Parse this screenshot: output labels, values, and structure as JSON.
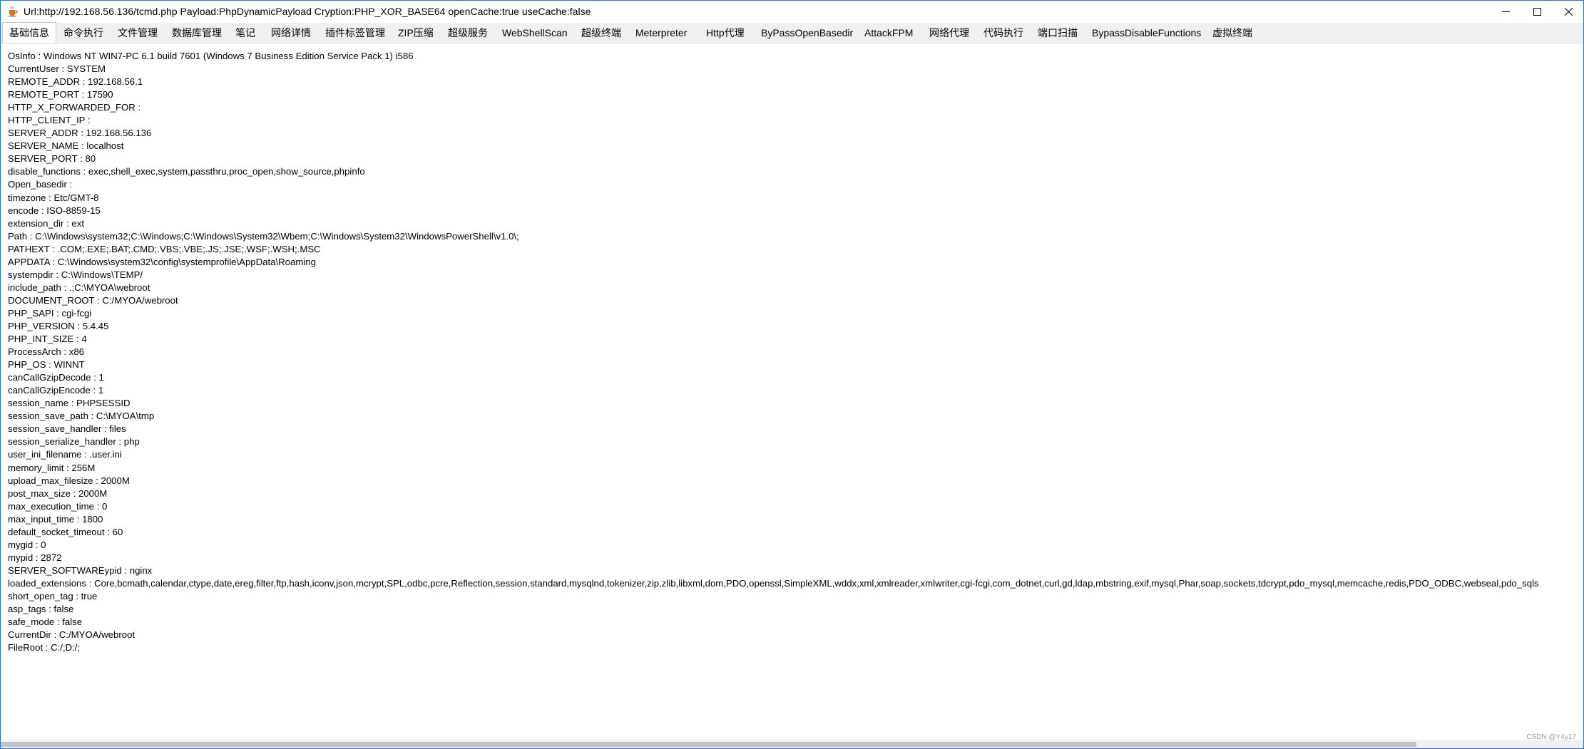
{
  "window": {
    "title": "Url:http://192.168.56.136/tcmd.php Payload:PhpDynamicPayload Cryption:PHP_XOR_BASE64 openCache:true useCache:false",
    "icons": {
      "app": "java-cup-icon",
      "minimize": "minimize-icon",
      "maximize": "maximize-icon",
      "close": "close-icon"
    }
  },
  "tabs": [
    {
      "label": "基础信息",
      "active": true
    },
    {
      "label": "命令执行"
    },
    {
      "label": "文件管理"
    },
    {
      "label": "数据库管理"
    },
    {
      "label": "笔记"
    },
    {
      "label": "网络详情"
    },
    {
      "label": "插件标签管理"
    },
    {
      "label": "ZIP压缩"
    },
    {
      "label": "超级服务"
    },
    {
      "label": "WebShellScan"
    },
    {
      "label": "超级终端"
    },
    {
      "label": "Meterpreter"
    },
    {
      "label": "Http代理"
    },
    {
      "label": "ByPassOpenBasedir"
    },
    {
      "label": "AttackFPM"
    },
    {
      "label": "网络代理"
    },
    {
      "label": "代码执行"
    },
    {
      "label": "端口扫描"
    },
    {
      "label": "BypassDisableFunctions"
    },
    {
      "label": "虚拟终端"
    }
  ],
  "info_lines": [
    "OsInfo : Windows NT WIN7-PC 6.1 build 7601 (Windows 7 Business Edition Service Pack 1) i586",
    "CurrentUser : SYSTEM",
    "REMOTE_ADDR : 192.168.56.1",
    "REMOTE_PORT : 17590",
    "HTTP_X_FORWARDED_FOR :",
    "HTTP_CLIENT_IP :",
    "SERVER_ADDR : 192.168.56.136",
    "SERVER_NAME : localhost",
    "SERVER_PORT : 80",
    "disable_functions : exec,shell_exec,system,passthru,proc_open,show_source,phpinfo",
    "Open_basedir :",
    "timezone : Etc/GMT-8",
    "encode : ISO-8859-15",
    "extension_dir : ext",
    "Path : C:\\Windows\\system32;C:\\Windows;C:\\Windows\\System32\\Wbem;C:\\Windows\\System32\\WindowsPowerShell\\v1.0\\;",
    "PATHEXT : .COM;.EXE;.BAT;.CMD;.VBS;.VBE;.JS;.JSE;.WSF;.WSH;.MSC",
    "APPDATA : C:\\Windows\\system32\\config\\systemprofile\\AppData\\Roaming",
    "systempdir : C:\\Windows\\TEMP/",
    "include_path : .;C:\\MYOA\\webroot",
    "DOCUMENT_ROOT : C:/MYOA/webroot",
    "PHP_SAPI : cgi-fcgi",
    "PHP_VERSION : 5.4.45",
    "PHP_INT_SIZE : 4",
    "ProcessArch : x86",
    "PHP_OS : WINNT",
    "canCallGzipDecode : 1",
    "canCallGzipEncode : 1",
    "session_name : PHPSESSID",
    "session_save_path : C:\\MYOA\\tmp",
    "session_save_handler : files",
    "session_serialize_handler : php",
    "user_ini_filename : .user.ini",
    "memory_limit : 256M",
    "upload_max_filesize : 2000M",
    "post_max_size : 2000M",
    "max_execution_time : 0",
    "max_input_time : 1800",
    "default_socket_timeout : 60",
    "mygid : 0",
    "mypid : 2872",
    "SERVER_SOFTWAREypid : nginx",
    "loaded_extensions : Core,bcmath,calendar,ctype,date,ereg,filter,ftp,hash,iconv,json,mcrypt,SPL,odbc,pcre,Reflection,session,standard,mysqlnd,tokenizer,zip,zlib,libxml,dom,PDO,openssl,SimpleXML,wddx,xml,xmlreader,xmlwriter,cgi-fcgi,com_dotnet,curl,gd,ldap,mbstring,exif,mysql,Phar,soap,sockets,tdcrypt,pdo_mysql,memcache,redis,PDO_ODBC,webseal,pdo_sqls",
    "short_open_tag : true",
    "asp_tags : false",
    "safe_mode : false",
    "CurrentDir : C:/MYOA/webroot",
    "FileRoot : C:/;D:/;"
  ],
  "watermark": "CSDN @Y4y17"
}
